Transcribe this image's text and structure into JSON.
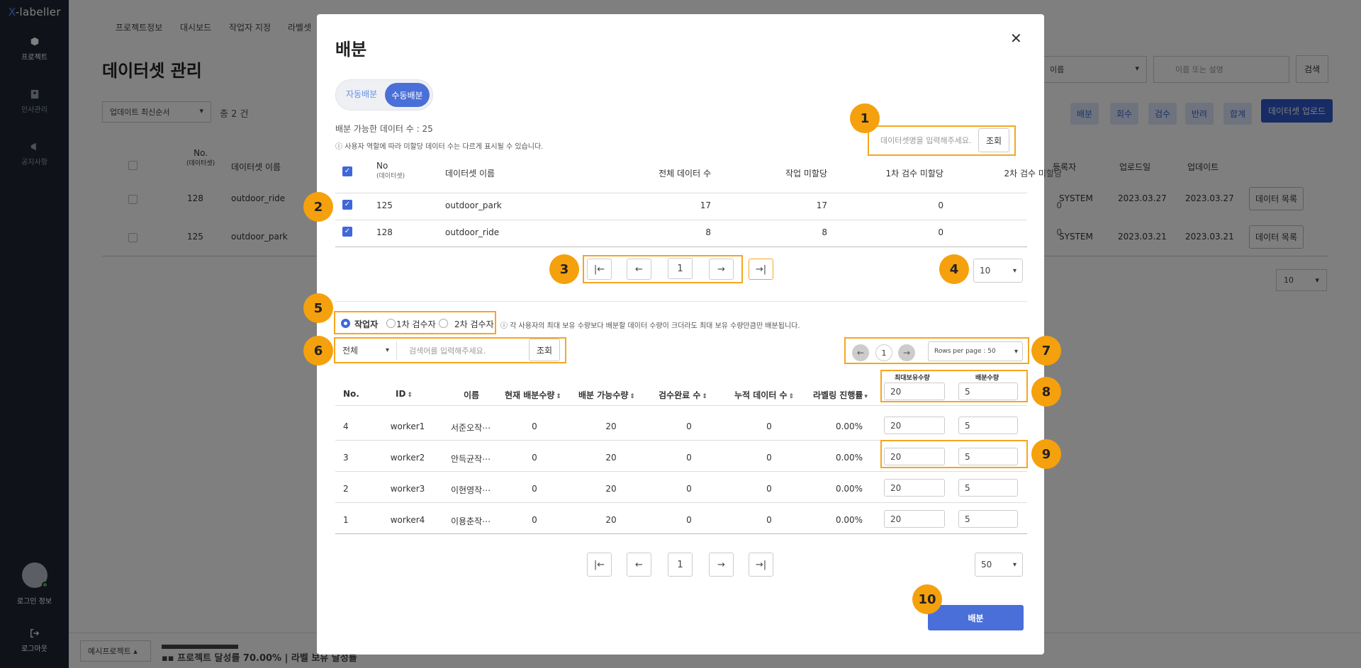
{
  "app": {
    "logo_prefix": "X",
    "logo_rest": "-labeller"
  },
  "sidebar": {
    "items": [
      {
        "label": "프로젝트"
      },
      {
        "label": "인사관리"
      },
      {
        "label": "공지사항"
      }
    ],
    "login_label": "로그인 정보",
    "logout_label": "로그아웃"
  },
  "background": {
    "tabs": [
      "프로젝트정보",
      "대시보드",
      "작업자 지정",
      "라벨셋"
    ],
    "title": "데이터셋 관리",
    "sort_select": "업데이트 최신순서",
    "total": "총 2 건",
    "filter_select": "이름",
    "search_placeholder": "이름 또는 설명",
    "search_button": "검색",
    "actions": [
      "배분",
      "회수",
      "검수",
      "반려",
      "합계"
    ],
    "upload_button": "데이터셋 업로드",
    "headers": {
      "no": "No.",
      "no_sub": "(데이터셋)",
      "name": "데이터셋 이름",
      "registrant": "등록자",
      "uploaded": "업로드일",
      "updated": "업데이트"
    },
    "rows": [
      {
        "no": "128",
        "name": "outdoor_ride",
        "registrant": "SYSTEM",
        "uploaded": "2023.03.27",
        "updated": "2023.03.27",
        "button": "데이터 목록"
      },
      {
        "no": "125",
        "name": "outdoor_park",
        "registrant": "SYSTEM",
        "uploaded": "2023.03.21",
        "updated": "2023.03.21",
        "button": "데이터 목록"
      }
    ],
    "page_size": "10",
    "footer_project": "예시프로젝트",
    "footer_text": "프로젝트 달성률 70.00%",
    "footer_text2": "라벨 보유 달성률"
  },
  "modal": {
    "title": "배분",
    "toggle": {
      "auto": "자동배분",
      "manual": "수동배분"
    },
    "available": "배분 가능한 데이터 수 : 25",
    "notice": "ⓘ 사용자 역할에 따라 미할당 데이터 수는 다르게 표시될 수 있습니다.",
    "dataset_search_placeholder": "데이터셋명을 입력해주세요.",
    "dataset_search_button": "조회",
    "dataset_table": {
      "headers": {
        "no": "No",
        "no_sub": "(데이터셋)",
        "name": "데이터셋 이름",
        "total": "전체 데이터 수",
        "unassigned": "작업 미할당",
        "rev1": "1차 검수 미할당",
        "rev2": "2차 검수 미할당"
      },
      "rows": [
        {
          "no": "125",
          "name": "outdoor_park",
          "total": "17",
          "unassigned": "17",
          "rev1": "0",
          "rev2": "0"
        },
        {
          "no": "128",
          "name": "outdoor_ride",
          "total": "8",
          "unassigned": "8",
          "rev1": "0",
          "rev2": "0"
        }
      ]
    },
    "dataset_page": "1",
    "dataset_page_size": "10",
    "roles": [
      "작업자",
      "1차 검수자",
      "2차 검수자"
    ],
    "role_notice": "ⓘ 각 사용자의 최대 보유 수량보다 배분할 데이터 수량이 크더라도 최대 보유 수량만큼만 배분됩니다.",
    "user_filter": "전체",
    "user_search_placeholder": "검색어를 입력해주세요.",
    "user_search_button": "조회",
    "mini_page": "1",
    "rows_per_page": "Rows per page : 50",
    "bulk": {
      "max_label": "최대보유수량",
      "alloc_label": "배분수량",
      "max_value": "20",
      "alloc_value": "5"
    },
    "user_table": {
      "headers": {
        "no": "No.",
        "id": "ID",
        "name": "이름",
        "current": "현재 배분수량",
        "available": "배분 가능수량",
        "reviewed": "검수완료 수",
        "accum": "누적 데이터 수",
        "progress": "라벨링 진행률"
      },
      "rows": [
        {
          "no": "4",
          "id": "worker1",
          "name": "서준오작⋯",
          "current": "0",
          "available": "20",
          "reviewed": "0",
          "accum": "0",
          "progress": "0.00%",
          "max": "20",
          "alloc": "5"
        },
        {
          "no": "3",
          "id": "worker2",
          "name": "안득균작⋯",
          "current": "0",
          "available": "20",
          "reviewed": "0",
          "accum": "0",
          "progress": "0.00%",
          "max": "20",
          "alloc": "5"
        },
        {
          "no": "2",
          "id": "worker3",
          "name": "이현영작⋯",
          "current": "0",
          "available": "20",
          "reviewed": "0",
          "accum": "0",
          "progress": "0.00%",
          "max": "20",
          "alloc": "5"
        },
        {
          "no": "1",
          "id": "worker4",
          "name": "이용춘작⋯",
          "current": "0",
          "available": "20",
          "reviewed": "0",
          "accum": "0",
          "progress": "0.00%",
          "max": "20",
          "alloc": "5"
        }
      ]
    },
    "user_page": "1",
    "user_page_size": "50",
    "submit": "배분",
    "badges": [
      "1",
      "2",
      "3",
      "4",
      "5",
      "6",
      "7",
      "8",
      "9",
      "10"
    ]
  }
}
